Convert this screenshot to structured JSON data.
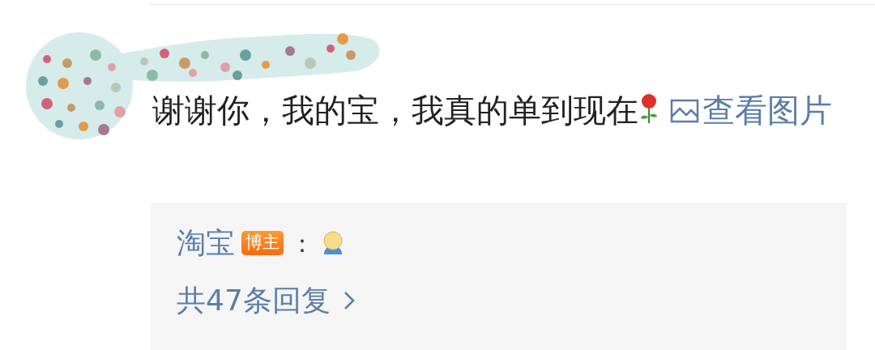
{
  "comment": {
    "text": "谢谢你，我的宝，我真的单到现在",
    "link": "查看图片"
  },
  "reply_box": {
    "author": "淘宝",
    "badge": "博主",
    "separator": "：",
    "more": "共47条回复"
  }
}
